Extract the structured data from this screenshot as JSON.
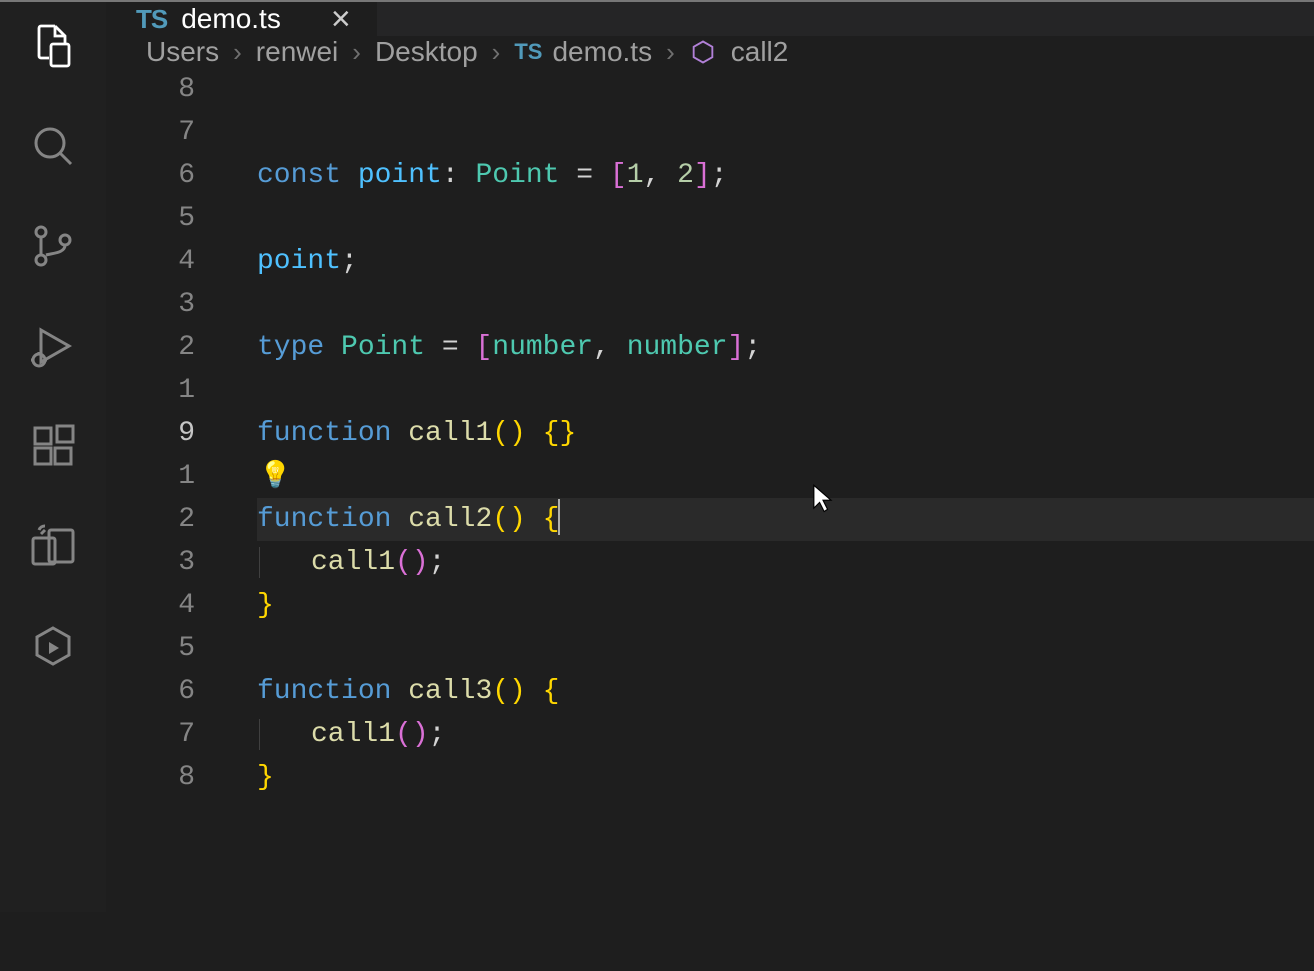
{
  "tab": {
    "icon_text": "TS",
    "label": "demo.ts",
    "close_glyph": "×"
  },
  "breadcrumb": {
    "parts": [
      "Users",
      "renwei",
      "Desktop"
    ],
    "file_icon": "TS",
    "file": "demo.ts",
    "symbol": "call2"
  },
  "gutter": {
    "numbers": [
      "8",
      "7",
      "6",
      "5",
      "4",
      "3",
      "2",
      "1",
      "9",
      "1",
      "2",
      "3",
      "4",
      "5",
      "6",
      "7",
      "8"
    ],
    "current_index": 8
  },
  "code": {
    "lines": [
      {
        "type": "code",
        "tokens": [
          {
            "cls": "tok-kw",
            "t": "const "
          },
          {
            "cls": "tok-var",
            "t": "point"
          },
          {
            "cls": "tok-punct",
            "t": ": "
          },
          {
            "cls": "tok-type",
            "t": "Point"
          },
          {
            "cls": "tok-punct",
            "t": " = "
          },
          {
            "cls": "tok-bracket-pink",
            "t": "["
          },
          {
            "cls": "tok-num",
            "t": "1"
          },
          {
            "cls": "tok-punct",
            "t": ", "
          },
          {
            "cls": "tok-num",
            "t": "2"
          },
          {
            "cls": "tok-bracket-pink",
            "t": "]"
          },
          {
            "cls": "tok-punct",
            "t": ";"
          }
        ]
      },
      {
        "type": "blank"
      },
      {
        "type": "code",
        "tokens": [
          {
            "cls": "tok-var",
            "t": "point"
          },
          {
            "cls": "tok-punct",
            "t": ";"
          }
        ]
      },
      {
        "type": "blank"
      },
      {
        "type": "code",
        "tokens": [
          {
            "cls": "tok-kw",
            "t": "type "
          },
          {
            "cls": "tok-type",
            "t": "Point"
          },
          {
            "cls": "tok-punct",
            "t": " = "
          },
          {
            "cls": "tok-bracket-pink",
            "t": "["
          },
          {
            "cls": "tok-type",
            "t": "number"
          },
          {
            "cls": "tok-punct",
            "t": ", "
          },
          {
            "cls": "tok-type",
            "t": "number"
          },
          {
            "cls": "tok-bracket-pink",
            "t": "]"
          },
          {
            "cls": "tok-punct",
            "t": ";"
          }
        ]
      },
      {
        "type": "blank"
      },
      {
        "type": "code",
        "tokens": [
          {
            "cls": "tok-kw",
            "t": "function "
          },
          {
            "cls": "tok-fn",
            "t": "call1"
          },
          {
            "cls": "tok-brace",
            "t": "()"
          },
          {
            "cls": "tok-punct",
            "t": " "
          },
          {
            "cls": "tok-brace",
            "t": "{}"
          }
        ]
      },
      {
        "type": "lightbulb"
      },
      {
        "type": "code",
        "current": true,
        "tokens": [
          {
            "cls": "tok-kw",
            "t": "function "
          },
          {
            "cls": "tok-fn",
            "t": "call2"
          },
          {
            "cls": "tok-brace",
            "t": "()"
          },
          {
            "cls": "tok-punct",
            "t": " "
          },
          {
            "cls": "tok-brace",
            "t": "{"
          }
        ],
        "cursor_after": true
      },
      {
        "type": "code",
        "indent": true,
        "tokens": [
          {
            "cls": "tok-fn",
            "t": "call1"
          },
          {
            "cls": "tok-bracket-pink",
            "t": "()"
          },
          {
            "cls": "tok-punct",
            "t": ";"
          }
        ]
      },
      {
        "type": "code",
        "tokens": [
          {
            "cls": "tok-brace",
            "t": "}"
          }
        ]
      },
      {
        "type": "blank"
      },
      {
        "type": "code",
        "tokens": [
          {
            "cls": "tok-kw",
            "t": "function "
          },
          {
            "cls": "tok-fn",
            "t": "call3"
          },
          {
            "cls": "tok-brace",
            "t": "()"
          },
          {
            "cls": "tok-punct",
            "t": " "
          },
          {
            "cls": "tok-brace",
            "t": "{"
          }
        ]
      },
      {
        "type": "code",
        "indent": true,
        "tokens": [
          {
            "cls": "tok-fn",
            "t": "call1"
          },
          {
            "cls": "tok-bracket-pink",
            "t": "()"
          },
          {
            "cls": "tok-punct",
            "t": ";"
          }
        ]
      },
      {
        "type": "code",
        "tokens": [
          {
            "cls": "tok-brace",
            "t": "}"
          }
        ]
      },
      {
        "type": "blank"
      },
      {
        "type": "blank"
      }
    ]
  }
}
